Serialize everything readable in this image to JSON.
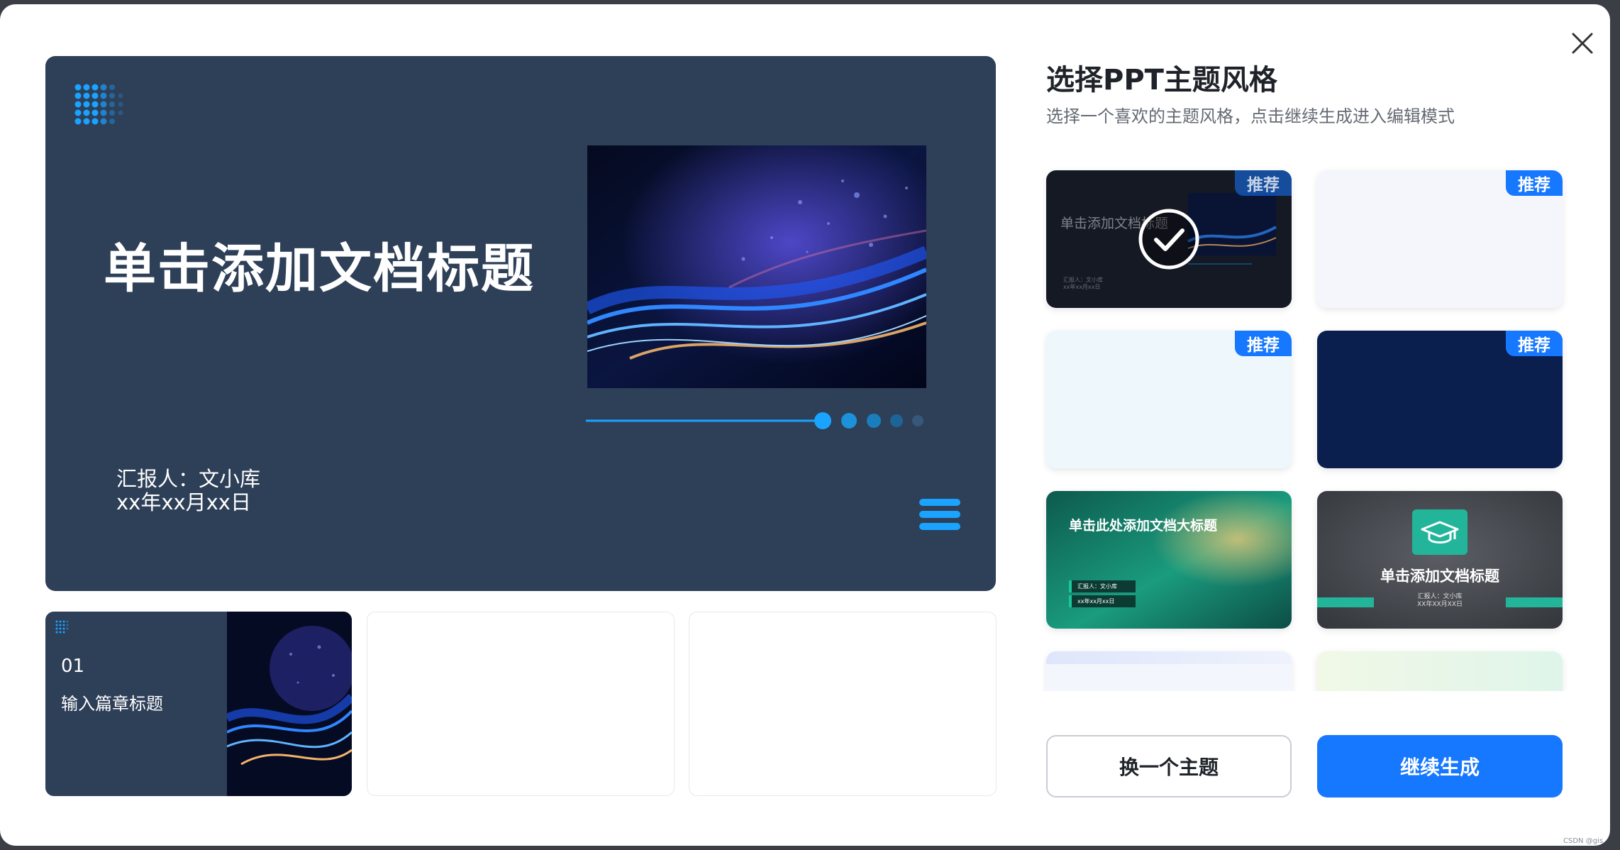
{
  "preview": {
    "title": "单击添加文档标题",
    "reporter": "汇报人：文小库",
    "date": "xx年xx月xx日",
    "accent_color": "#1aa3ff"
  },
  "thumbnails": [
    {
      "number": "01",
      "label": "输入篇章标题"
    }
  ],
  "panel": {
    "title": "选择PPT主题风格",
    "subtitle": "选择一个喜欢的主题风格，点击继续生成进入编辑模式",
    "recommended_badge": "推荐"
  },
  "themes": [
    {
      "style": "dark-navy-tech",
      "recommended": true,
      "selected": true,
      "title": "单击添加文档标题",
      "reporter": "汇报人：文小库",
      "date": "xx年xx月xx日"
    },
    {
      "style": "light-lavender",
      "recommended": true,
      "selected": false
    },
    {
      "style": "light-ice",
      "recommended": true,
      "selected": false
    },
    {
      "style": "deep-navy",
      "recommended": true,
      "selected": false
    },
    {
      "style": "green-gradient",
      "recommended": false,
      "selected": false,
      "title": "单击此处添加文档大标题",
      "reporter": "汇报人：文小库",
      "date": "xx年xx月xx日"
    },
    {
      "style": "chalkboard-education",
      "recommended": false,
      "selected": false,
      "title": "单击添加文档标题",
      "reporter": "汇报人：文小库",
      "date": "XX年XX月XX日"
    },
    {
      "style": "light-blue-partial",
      "recommended": false,
      "selected": false
    },
    {
      "style": "light-mint-partial",
      "recommended": false,
      "selected": false
    }
  ],
  "buttons": {
    "switch_label": "换一个主题",
    "continue_label": "继续生成"
  },
  "watermark": "CSDN @gis"
}
